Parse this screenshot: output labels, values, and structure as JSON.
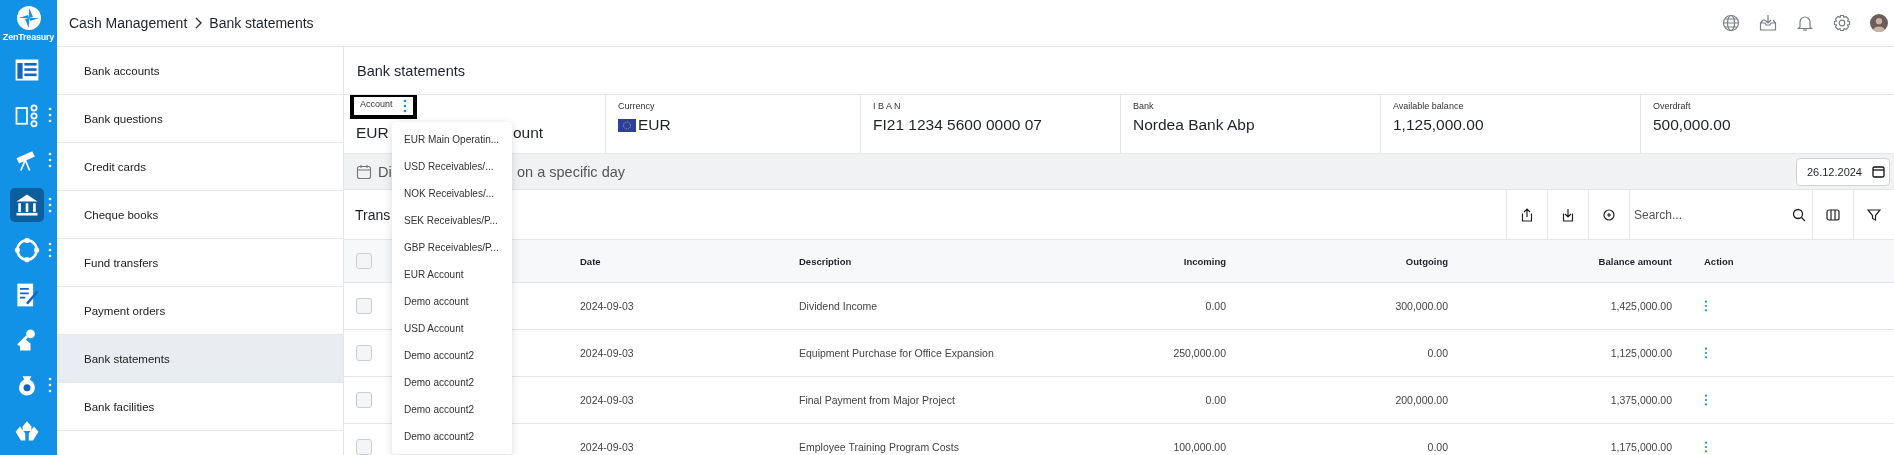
{
  "brand": {
    "name": "ZenTreasury"
  },
  "rail": [
    {
      "selected": false,
      "menu": false
    },
    {
      "selected": false,
      "menu": true
    },
    {
      "selected": false,
      "menu": true
    },
    {
      "selected": true,
      "menu": true
    },
    {
      "selected": false,
      "menu": true
    },
    {
      "selected": false,
      "menu": false
    },
    {
      "selected": false,
      "menu": false
    },
    {
      "selected": false,
      "menu": true
    },
    {
      "selected": false,
      "menu": false
    }
  ],
  "breadcrumb": [
    "Cash Management",
    "Bank statements"
  ],
  "submenu": [
    {
      "label": "Bank accounts",
      "selected": false
    },
    {
      "label": "Bank questions",
      "selected": false
    },
    {
      "label": "Credit cards",
      "selected": false
    },
    {
      "label": "Cheque books",
      "selected": false
    },
    {
      "label": "Fund transfers",
      "selected": false
    },
    {
      "label": "Payment orders",
      "selected": false
    },
    {
      "label": "Bank statements",
      "selected": true
    },
    {
      "label": "Bank facilities",
      "selected": false
    }
  ],
  "page_title": "Bank statements",
  "info": [
    {
      "label": "Account",
      "value_parts": [
        "EUR",
        "ount"
      ],
      "kind": "account"
    },
    {
      "label": "Currency",
      "value": "EUR",
      "kind": "currency"
    },
    {
      "label": "I B A N",
      "value": "FI21 1234 5600 0000 07",
      "kind": "text"
    },
    {
      "label": "Bank",
      "value": "Nordea Bank Abp",
      "kind": "text"
    },
    {
      "label": "Available balance",
      "value": "1,125,000.00",
      "kind": "text"
    },
    {
      "label": "Overdraft",
      "value": "500,000.00",
      "kind": "text"
    }
  ],
  "day_filter": {
    "title_parts": [
      "Di",
      "on a specific day"
    ],
    "date": "26.12.2024"
  },
  "transactions": {
    "title": "Trans",
    "search": {
      "placeholder": "Search..."
    },
    "columns": [
      "Date",
      "Description",
      "Incoming",
      "Outgoing",
      "Balance amount",
      "Action"
    ],
    "header_checked": false,
    "rows": [
      {
        "checked": false,
        "date": "2024-09-03",
        "description": "Dividend Income",
        "incoming": "0.00",
        "outgoing": "300,000.00",
        "balance": "1,425,000.00"
      },
      {
        "checked": false,
        "date": "2024-09-03",
        "description": "Equipment Purchase for Office Expansion",
        "incoming": "250,000.00",
        "outgoing": "0.00",
        "balance": "1,125,000.00"
      },
      {
        "checked": false,
        "date": "2024-09-03",
        "description": "Final Payment from Major Project",
        "incoming": "0.00",
        "outgoing": "200,000.00",
        "balance": "1,375,000.00"
      },
      {
        "checked": false,
        "date": "2024-09-03",
        "description": "Employee Training Program Costs",
        "incoming": "100,000.00",
        "outgoing": "0.00",
        "balance": "1,175,000.00"
      }
    ]
  },
  "account_menu": [
    "EUR Main Operatin...",
    "USD Receivables/...",
    "NOK Receivables/...",
    "SEK Receivables/P...",
    "GBP Receivables/P...",
    "EUR Account",
    "Demo account",
    "USD Account",
    "Demo account2",
    "Demo account2",
    "Demo account2",
    "Demo account2"
  ]
}
